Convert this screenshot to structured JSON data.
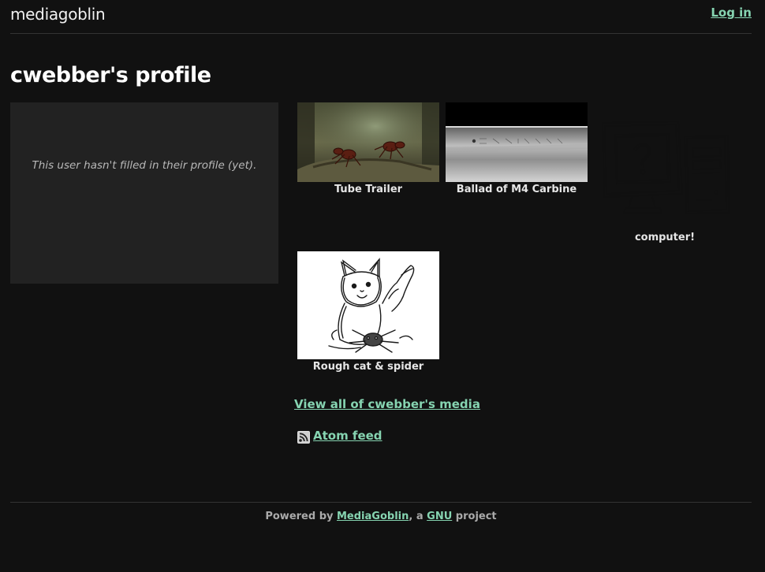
{
  "header": {
    "logo": "mediagoblin",
    "login_label": "Log in"
  },
  "profile": {
    "title": "cwebber's profile",
    "empty_message": "This user hasn't filled in their profile (yet)."
  },
  "media": [
    {
      "title": "Tube Trailer",
      "thumb_icon": "video-thumbnail"
    },
    {
      "title": "Ballad of M4 Carbine",
      "thumb_icon": "video-thumbnail"
    },
    {
      "title": "computer!",
      "thumb_icon": "computer-drawing"
    },
    {
      "title": "Rough cat & spider",
      "thumb_icon": "cat-sketch"
    }
  ],
  "links": {
    "view_all": "View all of cwebber's media",
    "atom_feed": "Atom feed"
  },
  "footer": {
    "powered_by": "Powered by",
    "mediagoblin_link": "MediaGoblin",
    "separator": ", a",
    "gnu_link": "GNU",
    "suffix": "project"
  },
  "colors": {
    "background": "#111111",
    "link": "#86d4b1",
    "profile_box": "#222222"
  }
}
